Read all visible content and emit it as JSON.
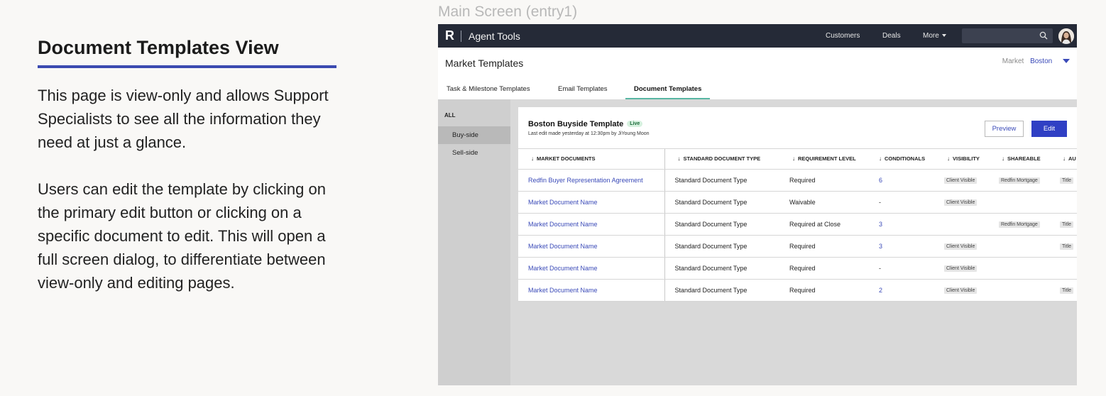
{
  "description": {
    "heading": "Document Templates View",
    "paragraph1": "This page is view-only and allows Support Specialists to see all the information they need at just a glance.",
    "paragraph2": "Users can edit the template by clicking on the primary edit button or clicking on a specific document to edit. This will open a full screen dialog, to differentiate between view-only and editing pages."
  },
  "screen_caption": "Main Screen (entry1)",
  "topbar": {
    "logo": "R",
    "app_title": "Agent Tools",
    "nav": {
      "customers": "Customers",
      "deals": "Deals",
      "more": "More"
    },
    "search_placeholder": ""
  },
  "header": {
    "page_title": "Market Templates",
    "market_label": "Market",
    "market_value": "Boston"
  },
  "tabs": [
    {
      "label": "Task & Milestone Templates"
    },
    {
      "label": "Email Templates"
    },
    {
      "label": "Document Templates"
    }
  ],
  "sidebar": {
    "all_label": "ALL",
    "items": [
      {
        "label": "Buy-side"
      },
      {
        "label": "Sell-side"
      }
    ]
  },
  "template": {
    "name": "Boston Buyside Template",
    "status_badge": "Live",
    "last_edit": "Last edit made yesterday at 12:30pm by JiYoung Moon",
    "preview_label": "Preview",
    "edit_label": "Edit"
  },
  "table": {
    "columns": [
      "MARKET DOCUMENTS",
      "STANDARD DOCUMENT TYPE",
      "REQUIREMENT LEVEL",
      "CONDITIONALS",
      "VISIBILITY",
      "SHAREABLE",
      "AU"
    ],
    "rows": [
      [
        "Redfin Buyer Representation Agreement",
        "Standard Document Type",
        "Required",
        "6",
        "Client Visible",
        "Redfin Mortgage",
        "Title"
      ],
      [
        "Market Document Name",
        "Standard Document Type",
        "Waivable",
        "-",
        "Client Visible",
        "",
        ""
      ],
      [
        "Market Document Name",
        "Standard Document Type",
        "Required at Close",
        "3",
        "",
        "Redfin Mortgage",
        "Title"
      ],
      [
        "Market Document Name",
        "Standard Document Type",
        "Required",
        "3",
        "Client Visible",
        "",
        "Title"
      ],
      [
        "Market Document Name",
        "Standard Document Type",
        "Required",
        "-",
        "Client Visible",
        "",
        ""
      ],
      [
        "Market Document Name",
        "Standard Document Type",
        "Required",
        "2",
        "Client Visible",
        "",
        "Title"
      ]
    ]
  },
  "colors": {
    "accent": "#3a4ab8",
    "primary_button": "#3040c4",
    "topbar": "#252a37",
    "tab_indicator": "#58b6a3",
    "heading_rule": "#3b4ab0"
  }
}
